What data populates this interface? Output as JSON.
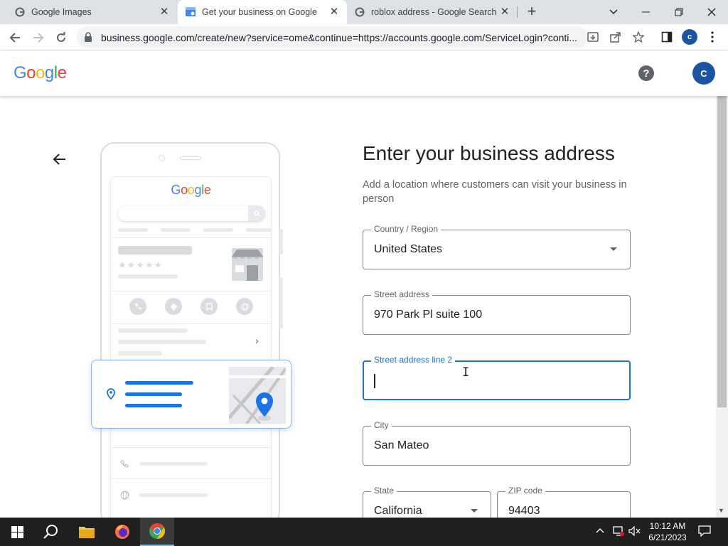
{
  "browser": {
    "tabs": [
      {
        "title": "Google Images",
        "active": false
      },
      {
        "title": "Get your business on Google",
        "active": true
      },
      {
        "title": "roblox address - Google Search",
        "active": false
      }
    ],
    "url": "business.google.com/create/new?service=ome&continue=https://accounts.google.com/ServiceLogin?conti...",
    "profile_initial": "c"
  },
  "header": {
    "logo": "Google",
    "avatar_initial": "C"
  },
  "phone_illustration": {
    "logo": "Google"
  },
  "form": {
    "title": "Enter your business address",
    "subtitle": "Add a location where customers can visit your business in person",
    "fields": {
      "country": {
        "label": "Country / Region",
        "value": "United States"
      },
      "street": {
        "label": "Street address",
        "value": "970 Park Pl suite 100"
      },
      "street2": {
        "label": "Street address line 2",
        "value": ""
      },
      "city": {
        "label": "City",
        "value": "San Mateo"
      },
      "state": {
        "label": "State",
        "value": "California"
      },
      "zip": {
        "label": "ZIP code",
        "value": "94403"
      }
    }
  },
  "taskbar": {
    "time": "10:12 AM",
    "date": "6/21/2023"
  },
  "colors": {
    "accent": "#1a73e8",
    "avatar": "#1a55a4",
    "google_blue": "#4285F4",
    "google_red": "#EA4335",
    "google_yellow": "#FBBC05",
    "google_green": "#34A853"
  }
}
